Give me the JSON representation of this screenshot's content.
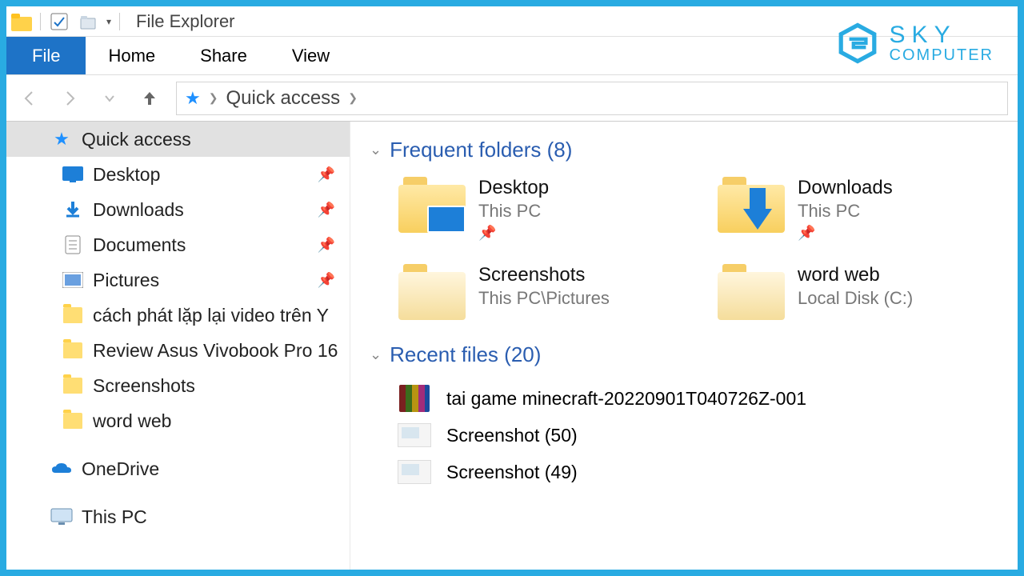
{
  "window": {
    "title": "File Explorer"
  },
  "ribbon": {
    "file": "File",
    "home": "Home",
    "share": "Share",
    "view": "View"
  },
  "address": {
    "location": "Quick access"
  },
  "sidebar": {
    "quick_access": "Quick access",
    "items": [
      {
        "label": "Desktop",
        "icon": "desktop",
        "pinned": true
      },
      {
        "label": "Downloads",
        "icon": "down",
        "pinned": true
      },
      {
        "label": "Documents",
        "icon": "doc",
        "pinned": true
      },
      {
        "label": "Pictures",
        "icon": "pic",
        "pinned": true
      },
      {
        "label": "cách phát lặp lại video trên Y",
        "icon": "folder",
        "pinned": false
      },
      {
        "label": "Review Asus Vivobook Pro 16",
        "icon": "folder",
        "pinned": false
      },
      {
        "label": "Screenshots",
        "icon": "folder",
        "pinned": false
      },
      {
        "label": "word web",
        "icon": "folder",
        "pinned": false
      }
    ],
    "onedrive": "OneDrive",
    "thispc": "This PC"
  },
  "sections": {
    "frequent": {
      "title": "Frequent folders (8)"
    },
    "recent": {
      "title": "Recent files (20)"
    }
  },
  "frequent_folders": [
    {
      "name": "Desktop",
      "location": "This PC",
      "overlay": "desktop",
      "pinned": true
    },
    {
      "name": "Downloads",
      "location": "This PC",
      "overlay": "down",
      "pinned": true
    },
    {
      "name": "Screenshots",
      "location": "This PC\\Pictures",
      "overlay": "open",
      "pinned": false
    },
    {
      "name": "word web",
      "location": "Local Disk (C:)",
      "overlay": "open",
      "pinned": false
    }
  ],
  "recent_files": [
    {
      "name": "tai game minecraft-20220901T040726Z-001",
      "type": "rar"
    },
    {
      "name": "Screenshot (50)",
      "type": "shot"
    },
    {
      "name": "Screenshot (49)",
      "type": "shot"
    }
  ],
  "brand": {
    "line1": "SKY",
    "line2": "COMPUTER"
  }
}
